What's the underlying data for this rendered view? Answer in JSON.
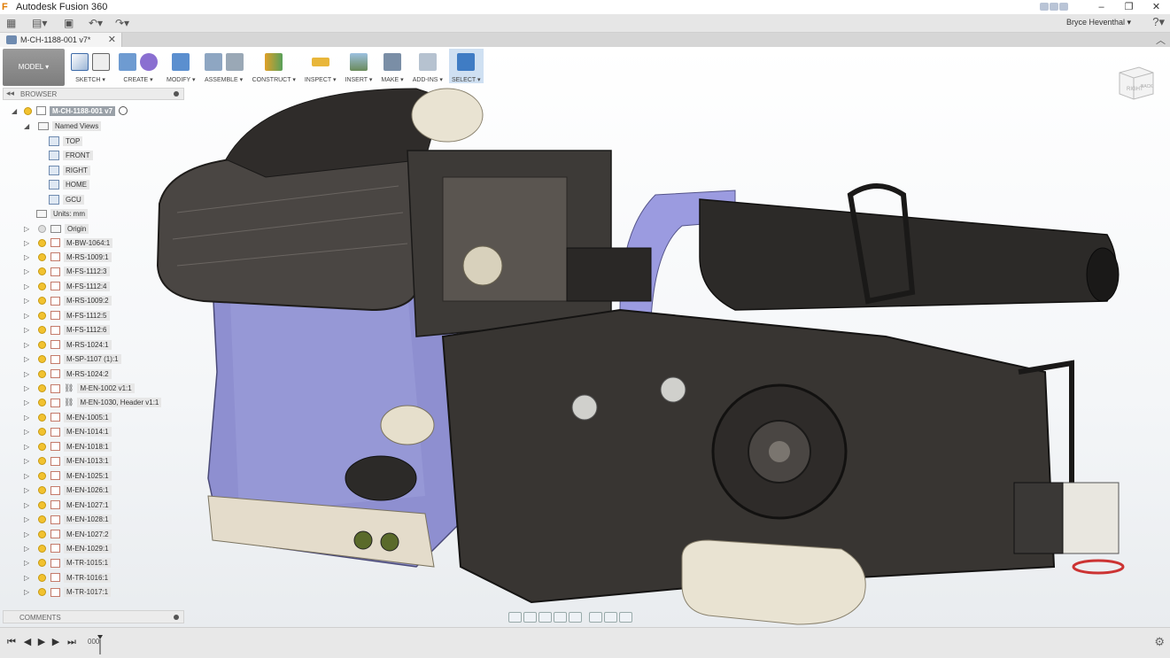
{
  "window": {
    "app_title": "Autodesk Fusion 360",
    "controls": [
      "–",
      "❐",
      "✕"
    ]
  },
  "quick_access": {
    "user_name": "Bryce Heventhal ▾",
    "help_icon": "help-icon"
  },
  "document": {
    "tab_label": "M-CH-1188-001 v7*",
    "close_glyph": "✕"
  },
  "toolbar": {
    "workspace": "MODEL ▾",
    "groups": [
      "SKETCH ▾",
      "CREATE ▾",
      "MODIFY ▾",
      "ASSEMBLE ▾",
      "CONSTRUCT ▾",
      "INSPECT ▾",
      "INSERT ▾",
      "MAKE ▾",
      "ADD-INS ▾",
      "SELECT ▾"
    ]
  },
  "browser": {
    "title": "BROWSER",
    "root": "M-CH-1188-001 v7",
    "named_views_label": "Named Views",
    "named_views": [
      "TOP",
      "FRONT",
      "RIGHT",
      "HOME",
      "GCU"
    ],
    "units": "Units: mm",
    "origin": "Origin",
    "components": [
      "M-BW-1064:1",
      "M-RS-1009:1",
      "M-FS-1112:3",
      "M-FS-1112:4",
      "M-RS-1009:2",
      "M-FS-1112:5",
      "M-FS-1112:6",
      "M-RS-1024:1",
      "M-SP-1107 (1):1",
      "M-RS-1024:2",
      "M-EN-1002 v1:1",
      "M-EN-1030, Header v1:1",
      "M-EN-1005:1",
      "M-EN-1014:1",
      "M-EN-1018:1",
      "M-EN-1013:1",
      "M-EN-1025:1",
      "M-EN-1026:1",
      "M-EN-1027:1",
      "M-EN-1028:1",
      "M-EN-1027:2",
      "M-EN-1029:1",
      "M-TR-1015:1",
      "M-TR-1016:1",
      "M-TR-1017:1"
    ]
  },
  "comments": {
    "title": "COMMENTS"
  },
  "viewcube": {
    "face_right": "RIGHT",
    "face_back": "BACK"
  },
  "timeline": {
    "counter": "000"
  },
  "colors": {
    "engine_purple": "#8e8fd0",
    "dark_metal": "#3a3836",
    "cream_parts": "#e9e3d2",
    "accent_blue": "#2f6fb5"
  }
}
